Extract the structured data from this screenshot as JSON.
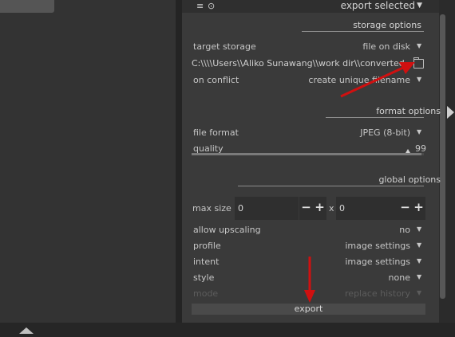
{
  "header": {
    "title": "export selected",
    "menu_icon": "hamburger-icon",
    "settings_icon": "gear-icon"
  },
  "storage": {
    "title": "storage options",
    "target_storage_label": "target storage",
    "target_storage_value": "file on disk",
    "path": "C:\\\\\\\\Users\\\\Aliko Sunawang\\\\work dir\\\\converted",
    "on_conflict_label": "on conflict",
    "on_conflict_value": "create unique filename"
  },
  "format": {
    "title": "format options",
    "file_format_label": "file format",
    "file_format_value": "JPEG (8-bit)",
    "quality_label": "quality",
    "quality_value": "99",
    "quality_fraction": 0.99
  },
  "global": {
    "title": "global options",
    "max_size_label": "max size",
    "width_value": "0",
    "x_label": "x",
    "height_value": "0",
    "minus": "−",
    "plus": "+",
    "allow_upscaling_label": "allow upscaling",
    "allow_upscaling_value": "no",
    "profile_label": "profile",
    "profile_value": "image settings",
    "intent_label": "intent",
    "intent_value": "image settings",
    "style_label": "style",
    "style_value": "none",
    "mode_label": "mode",
    "mode_value": "replace history"
  },
  "export_button": "export",
  "colors": {
    "annotation_arrow": "#d01010",
    "panel_bg": "#3a3a3a"
  }
}
